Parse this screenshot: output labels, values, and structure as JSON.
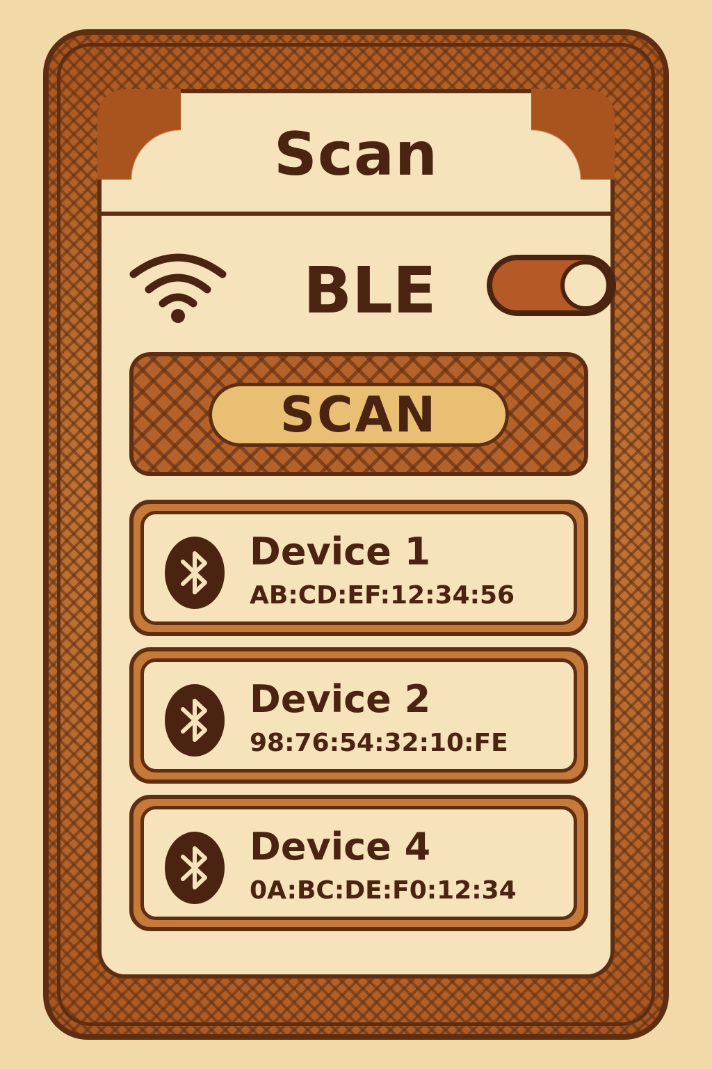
{
  "header": {
    "title": "Scan"
  },
  "ble": {
    "label": "BLE",
    "enabled": true
  },
  "scan_button": {
    "label": "SCAN"
  },
  "devices": [
    {
      "name": "Device 1",
      "mac": "AB:CD:EF:12:34:56",
      "icon": "bluetooth-icon"
    },
    {
      "name": "Device 2",
      "mac": "98:76:54:32:10:FE",
      "icon": "bluetooth-icon"
    },
    {
      "name": "Device 4",
      "mac": "0A:BC:DE:F0:12:34",
      "icon": "bluetooth-icon"
    }
  ],
  "colors": {
    "background": "#f2d9a8",
    "frame": "#b4612a",
    "ink": "#4a2410",
    "panel": "#f6e2bb",
    "accent": "#e8bf73"
  }
}
